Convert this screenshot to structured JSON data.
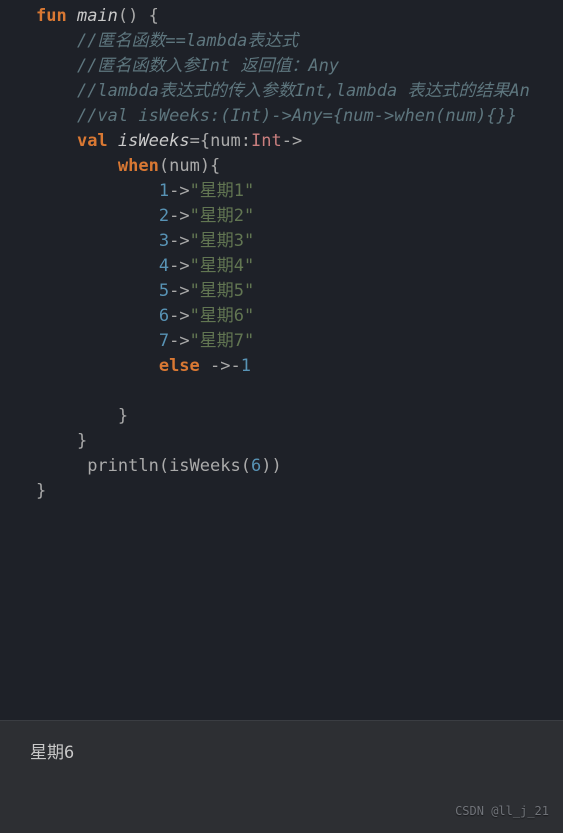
{
  "code": {
    "l1": {
      "kw": "fun",
      "fname": "main",
      "paren": "()",
      "brace": " {"
    },
    "c1": "//匿名函数==lambda表达式",
    "c2": "//匿名函数入参Int 返回值：Any",
    "c3": "//lambda表达式的传入参数Int,lambda 表达式的结果An",
    "c4": "//val isWeeks:(Int)->Any={num->when(num){}}",
    "l6": {
      "kw": "val",
      "var": "isWeeks",
      "eq": "={",
      "param": "num:",
      "type": "Int",
      "arrow": "->"
    },
    "l7": {
      "kw": "when",
      "open": "(",
      "ident": "num",
      "close": "){"
    },
    "cases": [
      {
        "num": "1",
        "arrow": "->",
        "str": "\"星期1\""
      },
      {
        "num": "2",
        "arrow": "->",
        "str": "\"星期2\""
      },
      {
        "num": "3",
        "arrow": "->",
        "str": "\"星期3\""
      },
      {
        "num": "4",
        "arrow": "->",
        "str": "\"星期4\""
      },
      {
        "num": "5",
        "arrow": "->",
        "str": "\"星期5\""
      },
      {
        "num": "6",
        "arrow": "->",
        "str": "\"星期6\""
      },
      {
        "num": "7",
        "arrow": "->",
        "str": "\"星期7\""
      }
    ],
    "else": {
      "kw": "else",
      "arrow": " ->-",
      "val": "1"
    },
    "close1": "}",
    "close2": "}",
    "print": {
      "before": " println(isWeeks(",
      "arg": "6",
      "after": "))"
    },
    "close3": "}"
  },
  "output": "星期6",
  "watermark": "CSDN @ll_j_21"
}
